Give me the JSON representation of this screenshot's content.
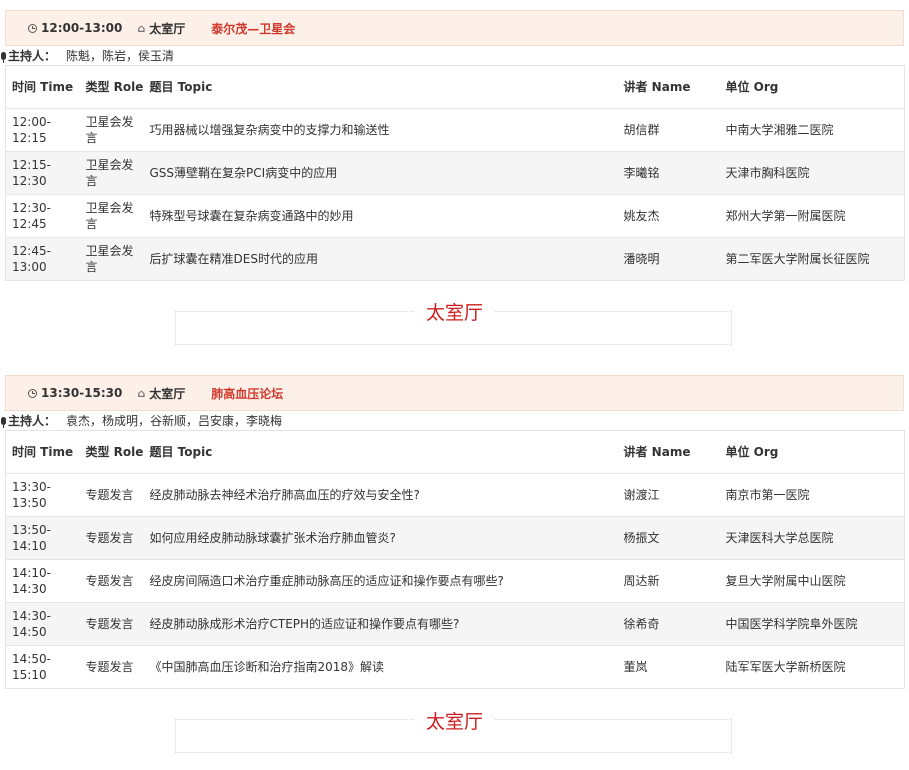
{
  "sessions": [
    {
      "time": "12:00-13:00",
      "room": "太室厅",
      "title": "泰尔茂—卫星会",
      "hosts_label": "主持人：",
      "hosts": "陈魁，陈岩，侯玉清",
      "columns": {
        "time": "时间 Time",
        "role": "类型 Role",
        "topic": "题目 Topic",
        "speaker": "讲者 Name",
        "org": "单位 Org"
      },
      "rows": [
        {
          "time": "12:00-12:15",
          "role": "卫星会发言",
          "topic": "巧用器械以增强复杂病变中的支撑力和输送性",
          "speaker": "胡信群",
          "org": "中南大学湘雅二医院"
        },
        {
          "time": "12:15-12:30",
          "role": "卫星会发言",
          "topic": "GSS薄壁鞘在复杂PCI病变中的应用",
          "speaker": "李曦铭",
          "org": "天津市胸科医院"
        },
        {
          "time": "12:30-12:45",
          "role": "卫星会发言",
          "topic": "特殊型号球囊在复杂病变通路中的妙用",
          "speaker": "姚友杰",
          "org": "郑州大学第一附属医院"
        },
        {
          "time": "12:45-13:00",
          "role": "卫星会发言",
          "topic": "后扩球囊在精准DES时代的应用",
          "speaker": "潘晓明",
          "org": "第二军医大学附属长征医院"
        }
      ]
    },
    {
      "time": "13:30-15:30",
      "room": "太室厅",
      "title": "肺高血压论坛",
      "hosts_label": "主持人：",
      "hosts": "袁杰，杨成明，谷新顺，吕安康，李晓梅",
      "columns": {
        "time": "时间 Time",
        "role": "类型 Role",
        "topic": "题目 Topic",
        "speaker": "讲者 Name",
        "org": "单位 Org"
      },
      "rows": [
        {
          "time": "13:30-13:50",
          "role": "专题发言",
          "topic": "经皮肺动脉去神经术治疗肺高血压的疗效与安全性?",
          "speaker": "谢渡江",
          "org": "南京市第一医院"
        },
        {
          "time": "13:50-14:10",
          "role": "专题发言",
          "topic": "如何应用经皮肺动脉球囊扩张术治疗肺血管炎?",
          "speaker": "杨振文",
          "org": "天津医科大学总医院"
        },
        {
          "time": "14:10-14:30",
          "role": "专题发言",
          "topic": "经皮房间隔造口术治疗重症肺动脉高压的适应证和操作要点有哪些?",
          "speaker": "周达新",
          "org": "复旦大学附属中山医院"
        },
        {
          "time": "14:30-14:50",
          "role": "专题发言",
          "topic": "经皮肺动脉成形术治疗CTEPH的适应证和操作要点有哪些?",
          "speaker": "徐希奇",
          "org": "中国医学科学院阜外医院"
        },
        {
          "time": "14:50-15:10",
          "role": "专题发言",
          "topic": "《中国肺高血压诊断和治疗指南2018》解读",
          "speaker": "董岚",
          "org": "陆军军医大学新桥医院"
        }
      ]
    }
  ],
  "room_headings": [
    "太室厅",
    "太室厅"
  ],
  "colors": {
    "header_bg": "#fdf0e8",
    "title_red": "#d03a2e",
    "room_red": "#cc1e1e",
    "stripe": "#f5f5f5"
  }
}
